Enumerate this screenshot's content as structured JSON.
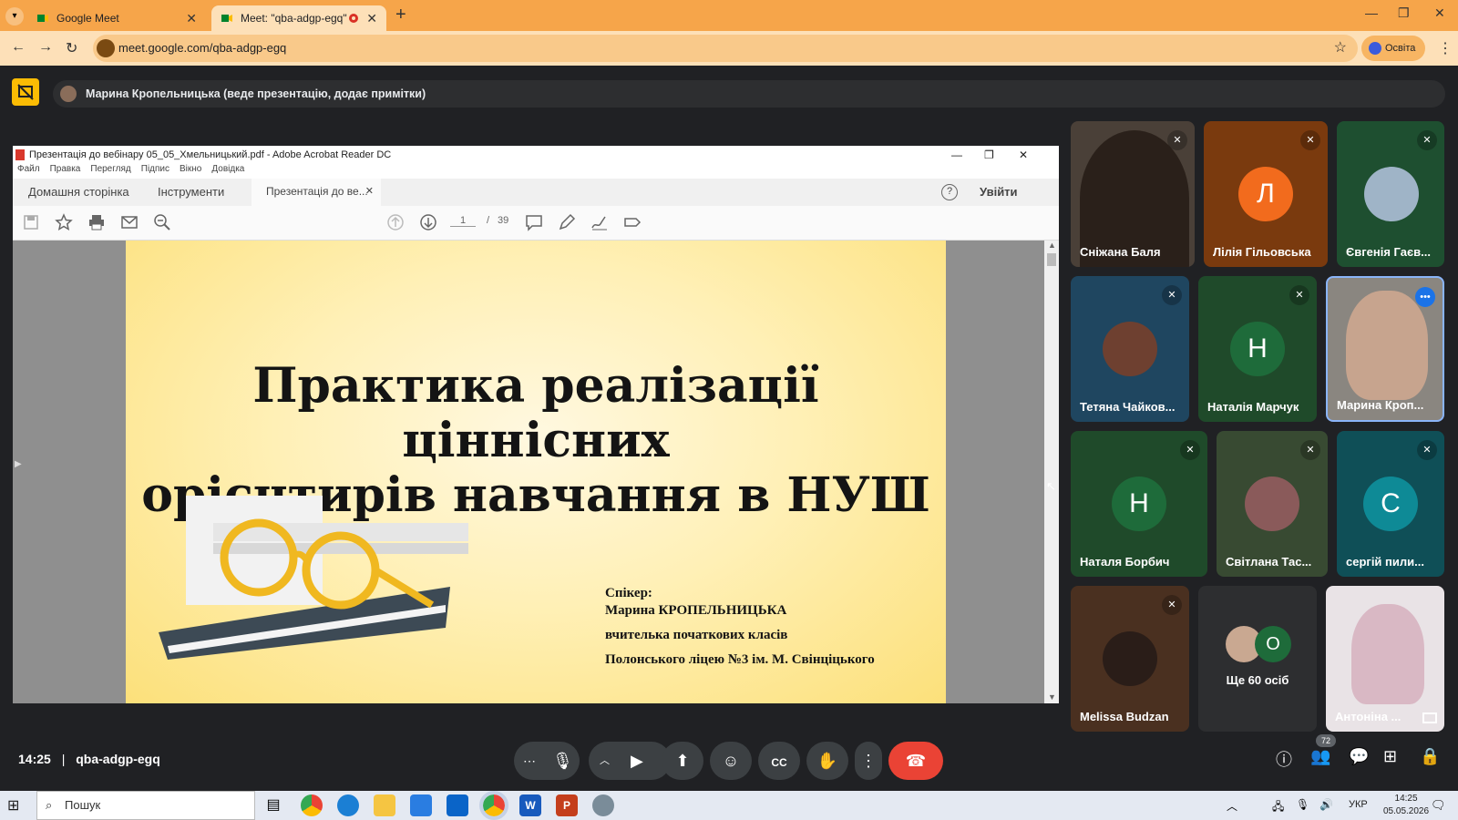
{
  "browser": {
    "tabs": [
      {
        "title": "Google Meet",
        "close": "✕"
      },
      {
        "title": "Meet: \"qba-adgp-egq\"",
        "close": "✕"
      }
    ],
    "new_tab": "+",
    "url": "meet.google.com/qba-adgp-egq",
    "profile_label": "Освіта"
  },
  "meet": {
    "presenting_banner": "Марина Кропельницька (веде презентацію, додає примітки)",
    "time": "14:25",
    "separator": "|",
    "meeting_code": "qba-adgp-egq",
    "people_count": "72",
    "participants": [
      {
        "name": "Сніжана Баля",
        "muted": true
      },
      {
        "name": "Лілія Гільовська",
        "initial": "Л",
        "muted": true
      },
      {
        "name": "Євгенія Гаєв...",
        "muted": true
      },
      {
        "name": "Тетяна Чайков...",
        "muted": true
      },
      {
        "name": "Наталія Марчук",
        "initial": "Н",
        "muted": true
      },
      {
        "name": "Марина Кроп...",
        "muted": false
      },
      {
        "name": "Наталя Борбич",
        "initial": "Н",
        "muted": true
      },
      {
        "name": "Світлана Тас...",
        "muted": true
      },
      {
        "name": "сергій пили...",
        "initial": "С",
        "muted": true
      },
      {
        "name": "Melissa Budzan",
        "muted": true
      },
      {
        "name": "Ще 60 осіб",
        "initial": "О"
      },
      {
        "name": "Антоніна ...",
        "muted": false
      }
    ]
  },
  "acrobat": {
    "window_title": "Презентація до вебінару 05_05_Хмельницький.pdf - Adobe Acrobat Reader DC",
    "menu": [
      "Файл",
      "Правка",
      "Перегляд",
      "Підпис",
      "Вікно",
      "Довідка"
    ],
    "tab_home": "Домашня сторінка",
    "tab_tools": "Інструменти",
    "tab_doc": "Презентація до ве...",
    "signin": "Увійти",
    "help": "?",
    "page_current": "1",
    "page_sep": "/",
    "page_total": "39"
  },
  "slide": {
    "title_line1": "Практика реалізації ціннісних",
    "title_line2": "орієнтирів навчання в НУШ",
    "speaker_label": "Спікер:",
    "speaker_name": "Марина КРОПЕЛЬНИЦЬКА",
    "speaker_role": "вчителька початкових класів",
    "speaker_school": "Полонського ліцею №3 ім. М. Свінціцького"
  },
  "taskbar": {
    "search_placeholder": "Пошук",
    "lang": "УКР",
    "time": "14:25",
    "date": "05.05.2026"
  },
  "colors": {
    "chrome_tab_strip": "#f6a54a",
    "meet_bg": "#202124",
    "end_call": "#ea4335",
    "orange_avatar": "#f26b1d",
    "green_avatar": "#1e6b3a",
    "teal_avatar": "#0e8a96"
  }
}
